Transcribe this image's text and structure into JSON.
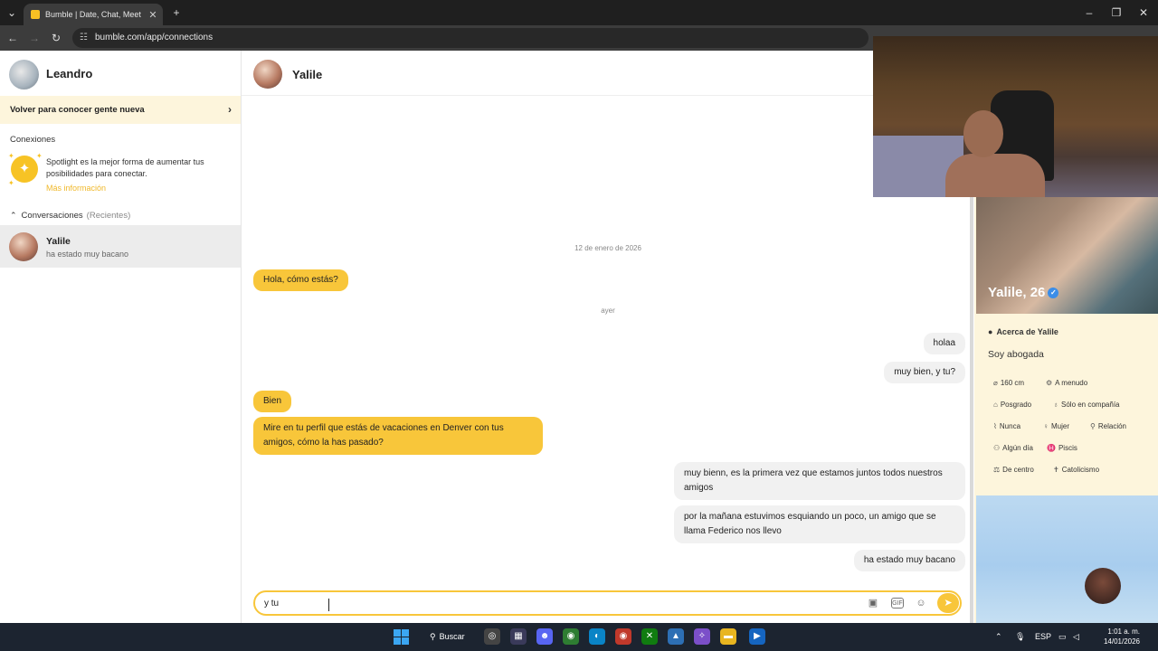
{
  "browser": {
    "tab_title": "Bumble | Date, Chat, Meet New",
    "url": "bumble.com/app/connections"
  },
  "sidebar": {
    "user_name": "Leandro",
    "back_link": "Volver para conocer gente nueva",
    "connections_label": "Conexiones",
    "spotlight_text": "Spotlight es la mejor forma de aumentar tus posibilidades para conectar.",
    "spotlight_more": "Más información",
    "conversations_label": "Conversaciones",
    "conversations_filter": "(Recientes)",
    "conversation": {
      "name": "Yalile",
      "preview": "ha estado muy bacano"
    }
  },
  "chat": {
    "partner_name": "Yalile",
    "date_1": "12 de enero de 2026",
    "date_2": "ayer",
    "messages": [
      {
        "from": "them",
        "text": "Hola, cómo estás?"
      },
      {
        "from": "me",
        "text": "holaa"
      },
      {
        "from": "me",
        "text": "muy bien, y tu?"
      },
      {
        "from": "them",
        "text": "Bien"
      },
      {
        "from": "them",
        "text": "Mire en tu perfil que estás de vacaciones en Denver con tus amigos, cómo la has pasado?"
      },
      {
        "from": "me",
        "text": "muy bienn, es la primera vez que estamos juntos todos nuestros amigos"
      },
      {
        "from": "me",
        "text": "por la mañana estuvimos esquiando un poco, un amigo que se llama Federico nos llevo"
      },
      {
        "from": "me",
        "text": "ha estado muy bacano"
      }
    ],
    "composer_value": "y tu"
  },
  "profile": {
    "name_age": "Yalile, 26",
    "about_title": "Acerca de Yalile",
    "about_text": "Soy abogada",
    "chips": [
      "160 cm",
      "A menudo",
      "Posgrado",
      "Sólo en compañía",
      "Nunca",
      "Mujer",
      "Relación",
      "Algún día",
      "Piscis",
      "De centro",
      "Catolicismo"
    ]
  },
  "taskbar": {
    "search_label": "Buscar",
    "language": "ESP",
    "time": "1:01 a. m.",
    "date": "14/01/2026"
  },
  "colors": {
    "accent": "#f8c63a",
    "sidebar_highlight": "#fdf5dc"
  }
}
